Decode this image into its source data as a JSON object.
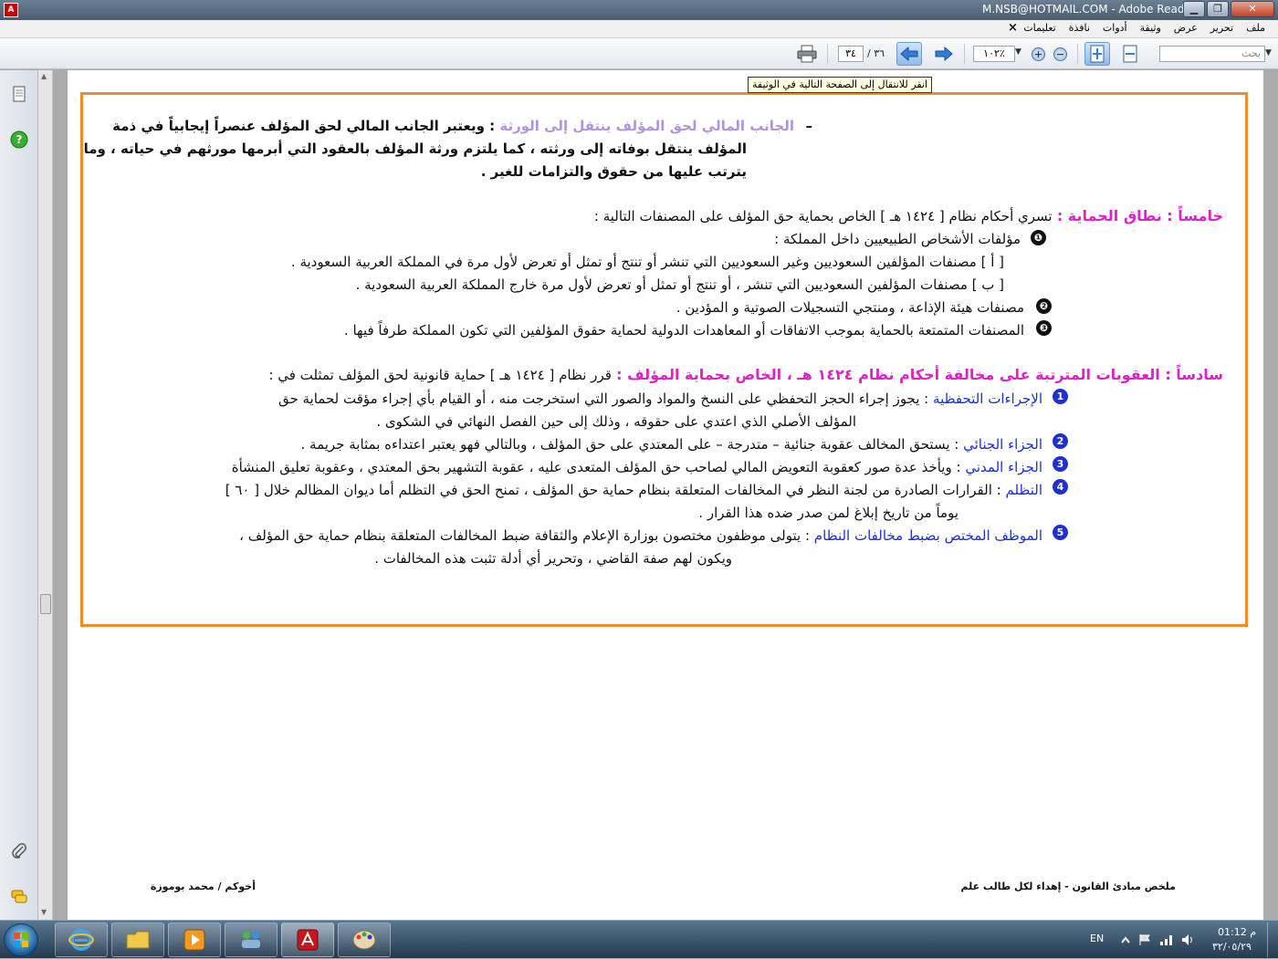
{
  "window": {
    "title": "M.NSB@HOTMAIL.COM - Adobe Reader",
    "min": "▁",
    "max": "❐",
    "close": "✕"
  },
  "menu": {
    "items": [
      "ملف",
      "تحرير",
      "عرض",
      "وثيقة",
      "أدوات",
      "نافذة",
      "تعليمات"
    ],
    "close": "×"
  },
  "toolbar": {
    "page_current": "٣٤",
    "page_total": "/ ٣٦",
    "zoom": "١٠٢٪",
    "zoom_in": "+",
    "zoom_out": "−",
    "search_placeholder": "بحث"
  },
  "tooltip": "انقر للانتقال إلى الصفحة التالية في الوثيقة",
  "doc": {
    "dash": "–",
    "p1_title": "الجانب المالي لحق المؤلف ينتقل إلى الورثة",
    "p1_line1": ": ويعتبر الجانب المالي لحق المؤلف عنصراً إيجابياً في ذمة",
    "p1_line2": "المؤلف ينتقل بوفاته إلى ورثته ، كما يلتزم ورثة المؤلف بالعقود التي أبرمها مورثهم في حياته ، وما",
    "p1_line3": "يترتب عليها من حقوق والتزامات للغير .",
    "s5_title": "خامساً : نطاق الحماية :",
    "s5_intro": "تسري أحكام نظام [ ١٤٢٤ هـ ] الخاص بحماية حق المؤلف على المصنفات التالية :",
    "s5_b1": "مؤلفات الأشخاص الطبيعيين داخل المملكة :",
    "s5_b1a": "[ أ ] مصنفات المؤلفين السعوديين وغير السعوديين التي تنشر أو تنتج أو تمثل أو تعرض لأول مرة في المملكة العربية السعودية .",
    "s5_b1b": "[ ب ] مصنفات المؤلفين السعوديين التي تنشر ، أو تنتج أو تمثل أو تعرض لأول مرة خارج المملكة العربية السعودية .",
    "s5_b2": "مصنفات هيئة الإذاعة ، ومنتجي التسجيلات الصوتية و المؤدين .",
    "s5_b3": "المصنفات المتمتعة بالحماية بموجب الاتفاقات أو المعاهدات الدولية لحماية حقوق المؤلفين التي تكون المملكة طرفاً فيها .",
    "s6_title": "سادساً : العقوبات المترتبة على مخالفة أحكام نظام ١٤٢٤ هـ ، الخاص بحماية المؤلف :",
    "s6_intro": "قرر نظام [ ١٤٢٤ هـ ] حماية قانونية لحق المؤلف تمثلت في :",
    "s6_i1_label": "الإجراءات التحفظية",
    "s6_i1_text": ": يجوز إجراء الحجز التحفظي على النسخ والمواد والصور التي استخرجت منه ، أو القيام بأي إجراء مؤقت لحماية حق",
    "s6_i1_cont": "المؤلف الأصلي الذي اعتدي على حقوقه ، وذلك إلى حين الفصل النهائي في الشكوى .",
    "s6_i2_label": "الجزاء الجنائي",
    "s6_i2_text": ": يستحق المخالف عقوبة جنائية – متدرجة – على المعتدي على حق المؤلف ، وبالتالي فهو يعتبر اعتداءه بمثابة جريمة .",
    "s6_i3_label": "الجزاء المدني",
    "s6_i3_text": ": ويأخذ عدة صور كعقوبة التعويض المالي لصاحب حق المؤلف المتعدى عليه ، عقوبة التشهير بحق المعتدي ، وعقوبة تعليق المنشأة",
    "s6_i4_label": "التظلم",
    "s6_i4_text": ": القرارات الصادرة من لجنة النظر في المخالفات المتعلقة بنظام حماية حق المؤلف ، تمنح الحق في التظلم أما ديوان المظالم خلال [ ٦٠ ]",
    "s6_i4_cont": "يوماً من تاريخ إبلاغ لمن صدر ضده هذا القرار .",
    "s6_i5_label": "الموظف المختص بضبط مخالفات النظام",
    "s6_i5_text": ": يتولى موظفون مختصون بوزارة الإعلام والثقافة ضبط المخالفات المتعلقة بنظام حماية حق المؤلف ،",
    "s6_i5_cont": "ويكون لهم صفة القاضي ، وتحرير أي أدلة تثبت هذه المخالفات .",
    "badges_black": [
      "❶",
      "❷",
      "❸"
    ],
    "badges_blue": [
      "1",
      "2",
      "3",
      "4",
      "5"
    ],
    "footer_right": "ملخص مبادئ القانون  -  إهداء لكل طالب علم",
    "footer_left": "أخوكم  /  محمد بوموزة"
  },
  "taskbar": {
    "lang": "EN",
    "time": "01:12 م",
    "date": "٣٢/٠٥/٢٩"
  },
  "colors": {
    "frame": "#f48a2b",
    "heading": "#e020c8",
    "label": "#1a2fd6",
    "lavender": "#b094e0"
  }
}
